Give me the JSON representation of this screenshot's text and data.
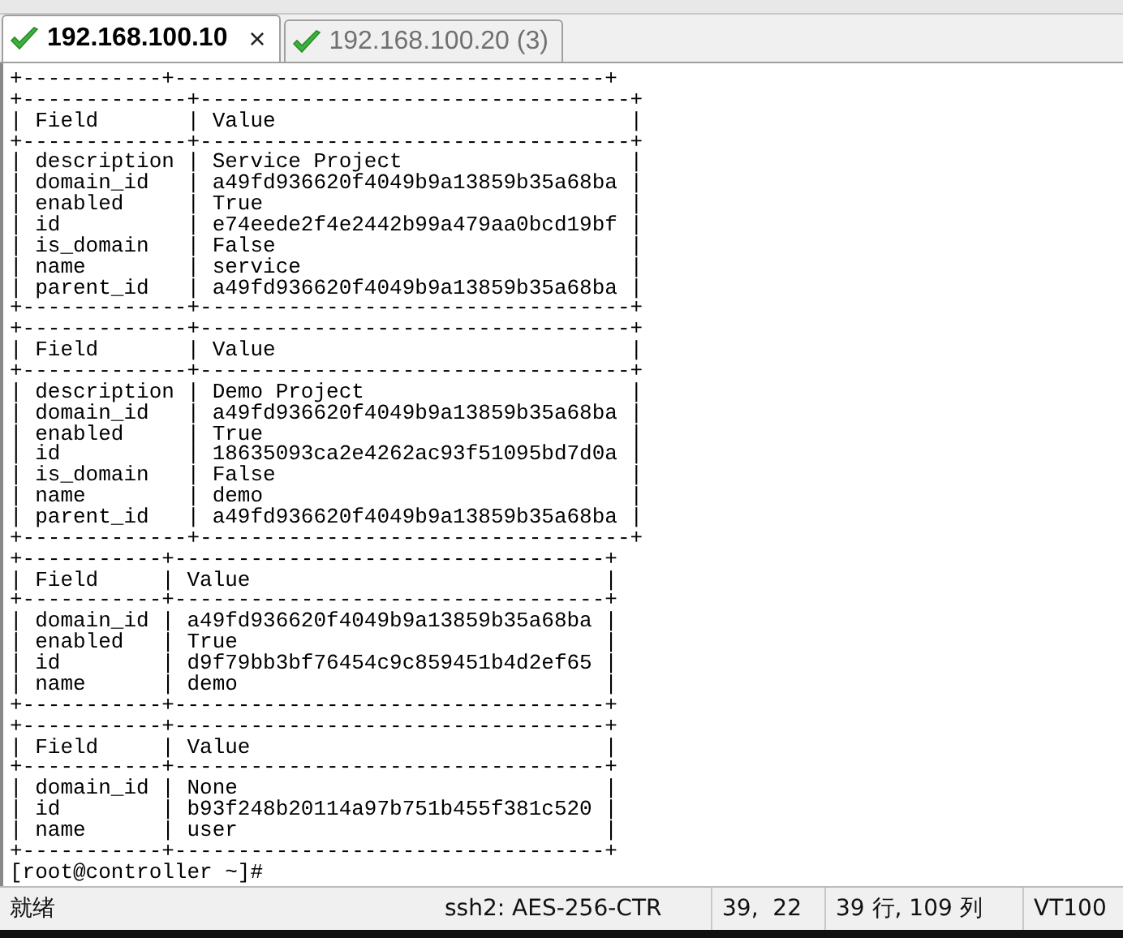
{
  "tabs": [
    {
      "label": "192.168.100.10",
      "selected": true,
      "connected": true,
      "close": "×"
    },
    {
      "label": "192.168.100.20 (3)",
      "selected": false,
      "connected": true
    }
  ],
  "terminal": {
    "lines": [
      "+-----------+----------------------------------+",
      "+-------------+----------------------------------+",
      "| Field       | Value                            |",
      "+-------------+----------------------------------+",
      "| description | Service Project                  |",
      "| domain_id   | a49fd936620f4049b9a13859b35a68ba |",
      "| enabled     | True                             |",
      "| id          | e74eede2f4e2442b99a479aa0bcd19bf |",
      "| is_domain   | False                            |",
      "| name        | service                          |",
      "| parent_id   | a49fd936620f4049b9a13859b35a68ba |",
      "+-------------+----------------------------------+",
      "+-------------+----------------------------------+",
      "| Field       | Value                            |",
      "+-------------+----------------------------------+",
      "| description | Demo Project                     |",
      "| domain_id   | a49fd936620f4049b9a13859b35a68ba |",
      "| enabled     | True                             |",
      "| id          | 18635093ca2e4262ac93f51095bd7d0a |",
      "| is_domain   | False                            |",
      "| name        | demo                             |",
      "| parent_id   | a49fd936620f4049b9a13859b35a68ba |",
      "+-------------+----------------------------------+",
      "+-----------+----------------------------------+",
      "| Field     | Value                            |",
      "+-----------+----------------------------------+",
      "| domain_id | a49fd936620f4049b9a13859b35a68ba |",
      "| enabled   | True                             |",
      "| id        | d9f79bb3bf76454c9c859451b4d2ef65 |",
      "| name      | demo                             |",
      "+-----------+----------------------------------+",
      "+-----------+----------------------------------+",
      "| Field     | Value                            |",
      "+-----------+----------------------------------+",
      "| domain_id | None                             |",
      "| id        | b93f248b20114a97b751b455f381c520 |",
      "| name      | user                             |",
      "+-----------+----------------------------------+",
      "[root@controller ~]#"
    ]
  },
  "status_bar": {
    "state": "就绪",
    "cipher": "ssh2: AES-256-CTR",
    "cursor": "39,  22",
    "size": "39 行, 109 列",
    "terminal_type": "VT100"
  }
}
